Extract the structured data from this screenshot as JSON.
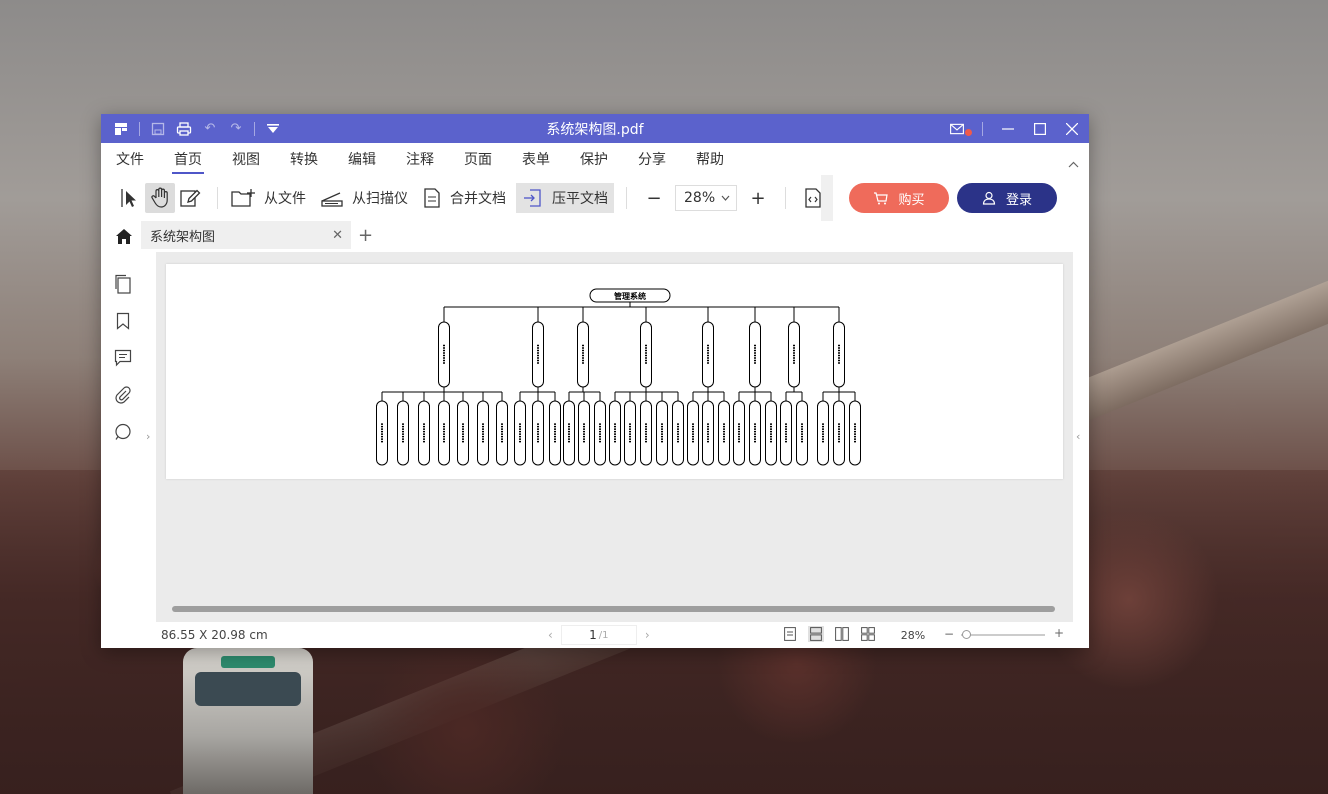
{
  "window": {
    "title": "系统架构图.pdf"
  },
  "menu": [
    {
      "label": "文件"
    },
    {
      "label": "首页"
    },
    {
      "label": "视图"
    },
    {
      "label": "转换"
    },
    {
      "label": "编辑"
    },
    {
      "label": "注释"
    },
    {
      "label": "页面"
    },
    {
      "label": "表单"
    },
    {
      "label": "保护"
    },
    {
      "label": "分享"
    },
    {
      "label": "帮助"
    }
  ],
  "menu_active": "首页",
  "toolbar": {
    "from_file": "从文件",
    "from_scanner": "从扫描仪",
    "merge_docs": "合并文档",
    "flatten_docs": "压平文档",
    "zoom_value": "28%",
    "buy_label": "购买",
    "login_label": "登录"
  },
  "tabs": {
    "doc_tab_label": "系统架构图"
  },
  "diagram": {
    "root_label": "管理系统"
  },
  "status": {
    "dimensions": "86.55 X 20.98 cm",
    "current_page": "1",
    "total_pages": "/1",
    "zoom": "28%"
  },
  "colors": {
    "titlebar": "#5b62cc",
    "buy_button": "#ef6b5b",
    "login_button": "#2b3388",
    "active_underline": "#4f56c8"
  }
}
